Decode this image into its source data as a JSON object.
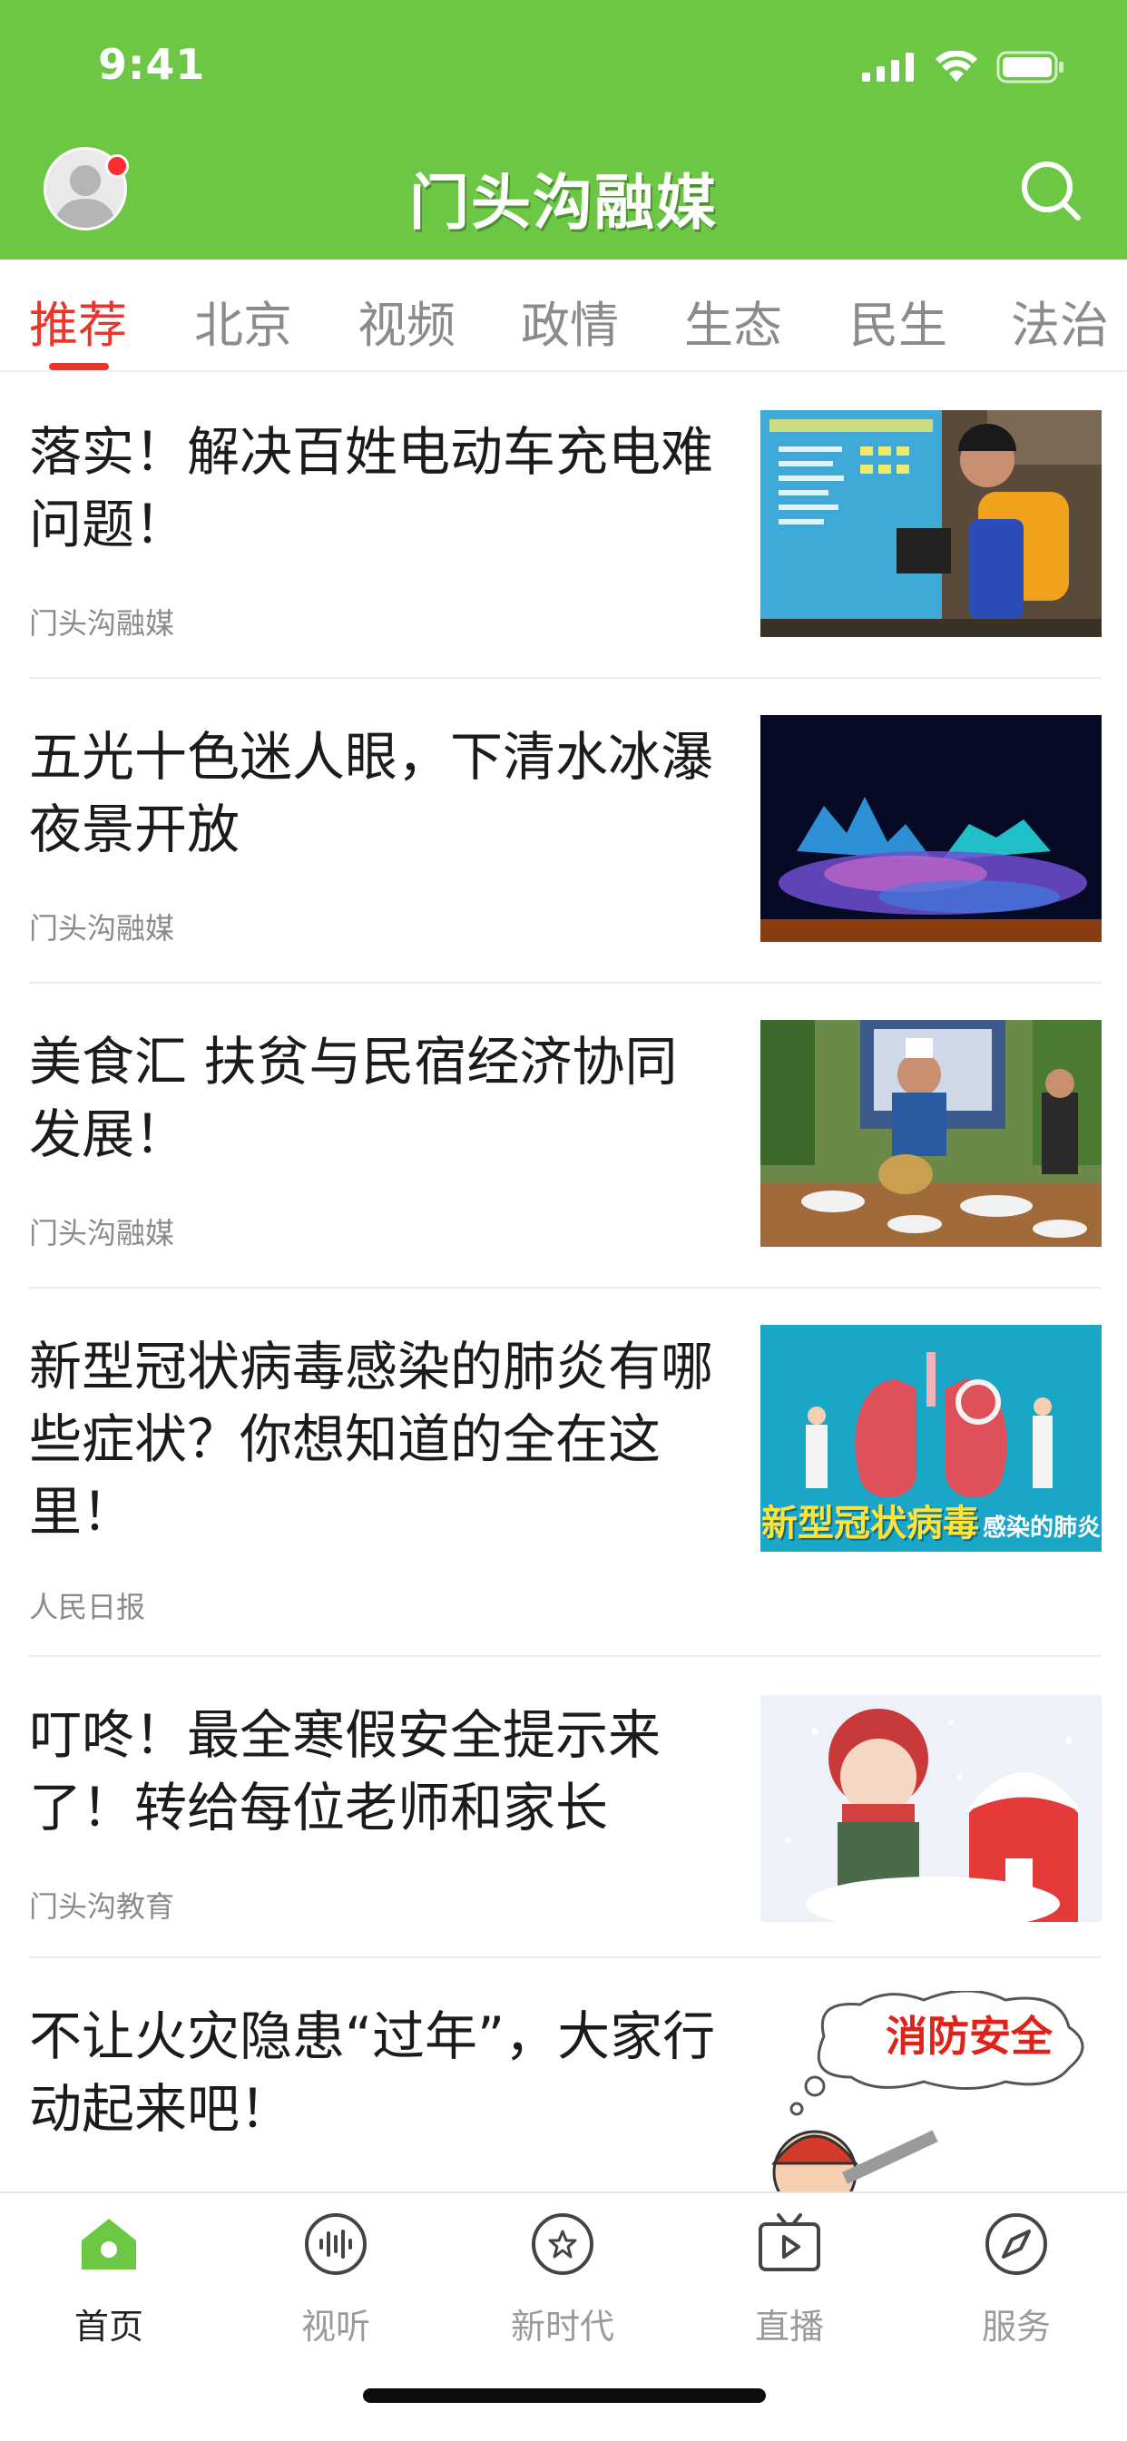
{
  "status": {
    "time": "9:41"
  },
  "header": {
    "title": "门头沟融媒",
    "has_notification": true
  },
  "tabs": [
    {
      "label": "推荐",
      "active": true
    },
    {
      "label": "北京"
    },
    {
      "label": "视频"
    },
    {
      "label": "政情"
    },
    {
      "label": "生态"
    },
    {
      "label": "民生"
    },
    {
      "label": "法治"
    }
  ],
  "articles": [
    {
      "title": "落实！解决百姓电动车充电难问题！",
      "source": "门头沟融媒"
    },
    {
      "title": "五光十色迷人眼，下清水冰瀑夜景开放",
      "source": "门头沟融媒"
    },
    {
      "title": "美食汇 扶贫与民宿经济协同发展！",
      "source": "门头沟融媒"
    },
    {
      "title": "新型冠状病毒感染的肺炎有哪些症状？你想知道的全在这里！",
      "source": "人民日报",
      "thumb_caption_strong": "新型冠状病毒",
      "thumb_caption": "感染的肺炎"
    },
    {
      "title": "叮咚！最全寒假安全提示来了！转给每位老师和家长",
      "source": "门头沟教育"
    },
    {
      "title": "不让火灾隐患“过年”，大家行动起来吧！",
      "thumb_caption": "消防安全"
    }
  ],
  "nav": [
    {
      "label": "首页",
      "icon": "home-icon",
      "active": true
    },
    {
      "label": "视听",
      "icon": "audio-wave-icon"
    },
    {
      "label": "新时代",
      "icon": "star-badge-icon"
    },
    {
      "label": "直播",
      "icon": "live-video-icon"
    },
    {
      "label": "服务",
      "icon": "compass-icon"
    }
  ],
  "colors": {
    "brand_green": "#6cc844",
    "active_tab_red": "#e8362d",
    "text_primary": "#1b1b1b",
    "text_secondary": "#8a8a8a"
  }
}
